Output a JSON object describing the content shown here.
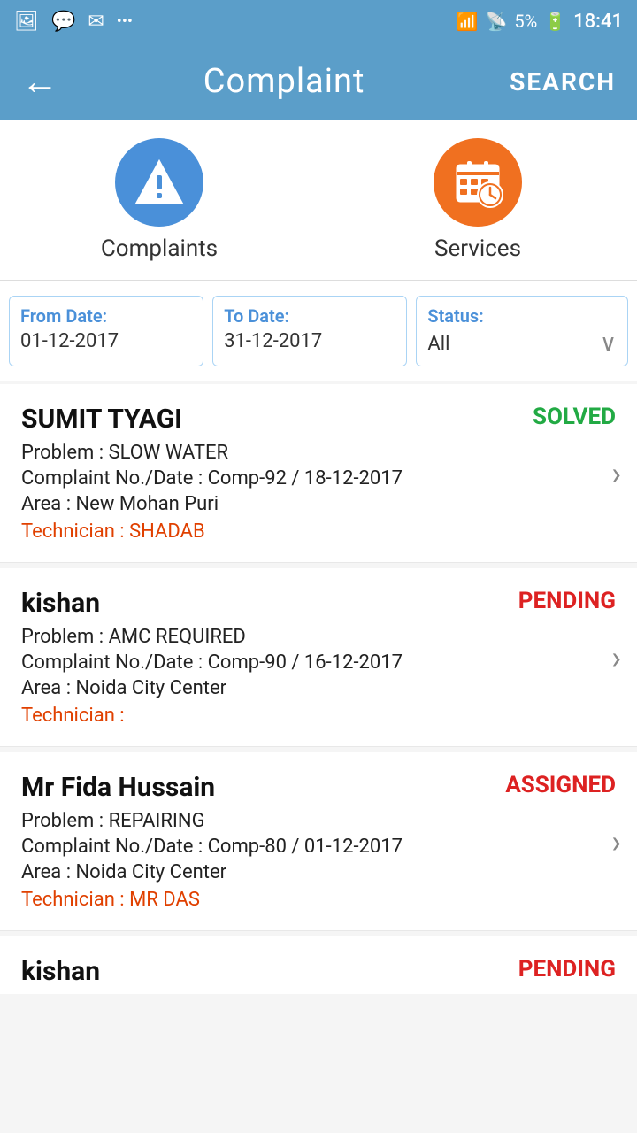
{
  "statusBar": {
    "icons_left": [
      "image-icon",
      "chat-icon",
      "mail-icon",
      "more-icon"
    ],
    "wifi": "wifi",
    "signal": "signal",
    "battery": "5%",
    "time": "18:41"
  },
  "appBar": {
    "back_label": "←",
    "title": "Complaint",
    "search_label": "SEARCH"
  },
  "tabs": [
    {
      "id": "complaints",
      "label": "Complaints",
      "icon_type": "warning",
      "color": "blue"
    },
    {
      "id": "services",
      "label": "Services",
      "icon_type": "calendar",
      "color": "orange"
    }
  ],
  "filters": {
    "from_date_label": "From Date:",
    "from_date_value": "01-12-2017",
    "to_date_label": "To Date:",
    "to_date_value": "31-12-2017",
    "status_label": "Status:",
    "status_value": "All"
  },
  "complaints": [
    {
      "name": "SUMIT TYAGI",
      "status": "SOLVED",
      "status_type": "solved",
      "problem": "Problem : SLOW WATER",
      "complaint_no_date": "Complaint No./Date : Comp-92 / 18-12-2017",
      "area": "Area : New Mohan Puri",
      "technician": "Technician : SHADAB"
    },
    {
      "name": "kishan",
      "status": "PENDING",
      "status_type": "pending",
      "problem": "Problem : AMC REQUIRED",
      "complaint_no_date": "Complaint No./Date : Comp-90 / 16-12-2017",
      "area": "Area : Noida City Center",
      "technician": "Technician : "
    },
    {
      "name": "Mr Fida Hussain",
      "status": "ASSIGNED",
      "status_type": "assigned",
      "problem": "Problem : REPAIRING",
      "complaint_no_date": "Complaint No./Date : Comp-80 / 01-12-2017",
      "area": "Area : Noida City Center",
      "technician": "Technician : MR DAS"
    },
    {
      "name": "kishan",
      "status": "PENDING",
      "status_type": "pending",
      "problem": "",
      "complaint_no_date": "",
      "area": "",
      "technician": ""
    }
  ]
}
